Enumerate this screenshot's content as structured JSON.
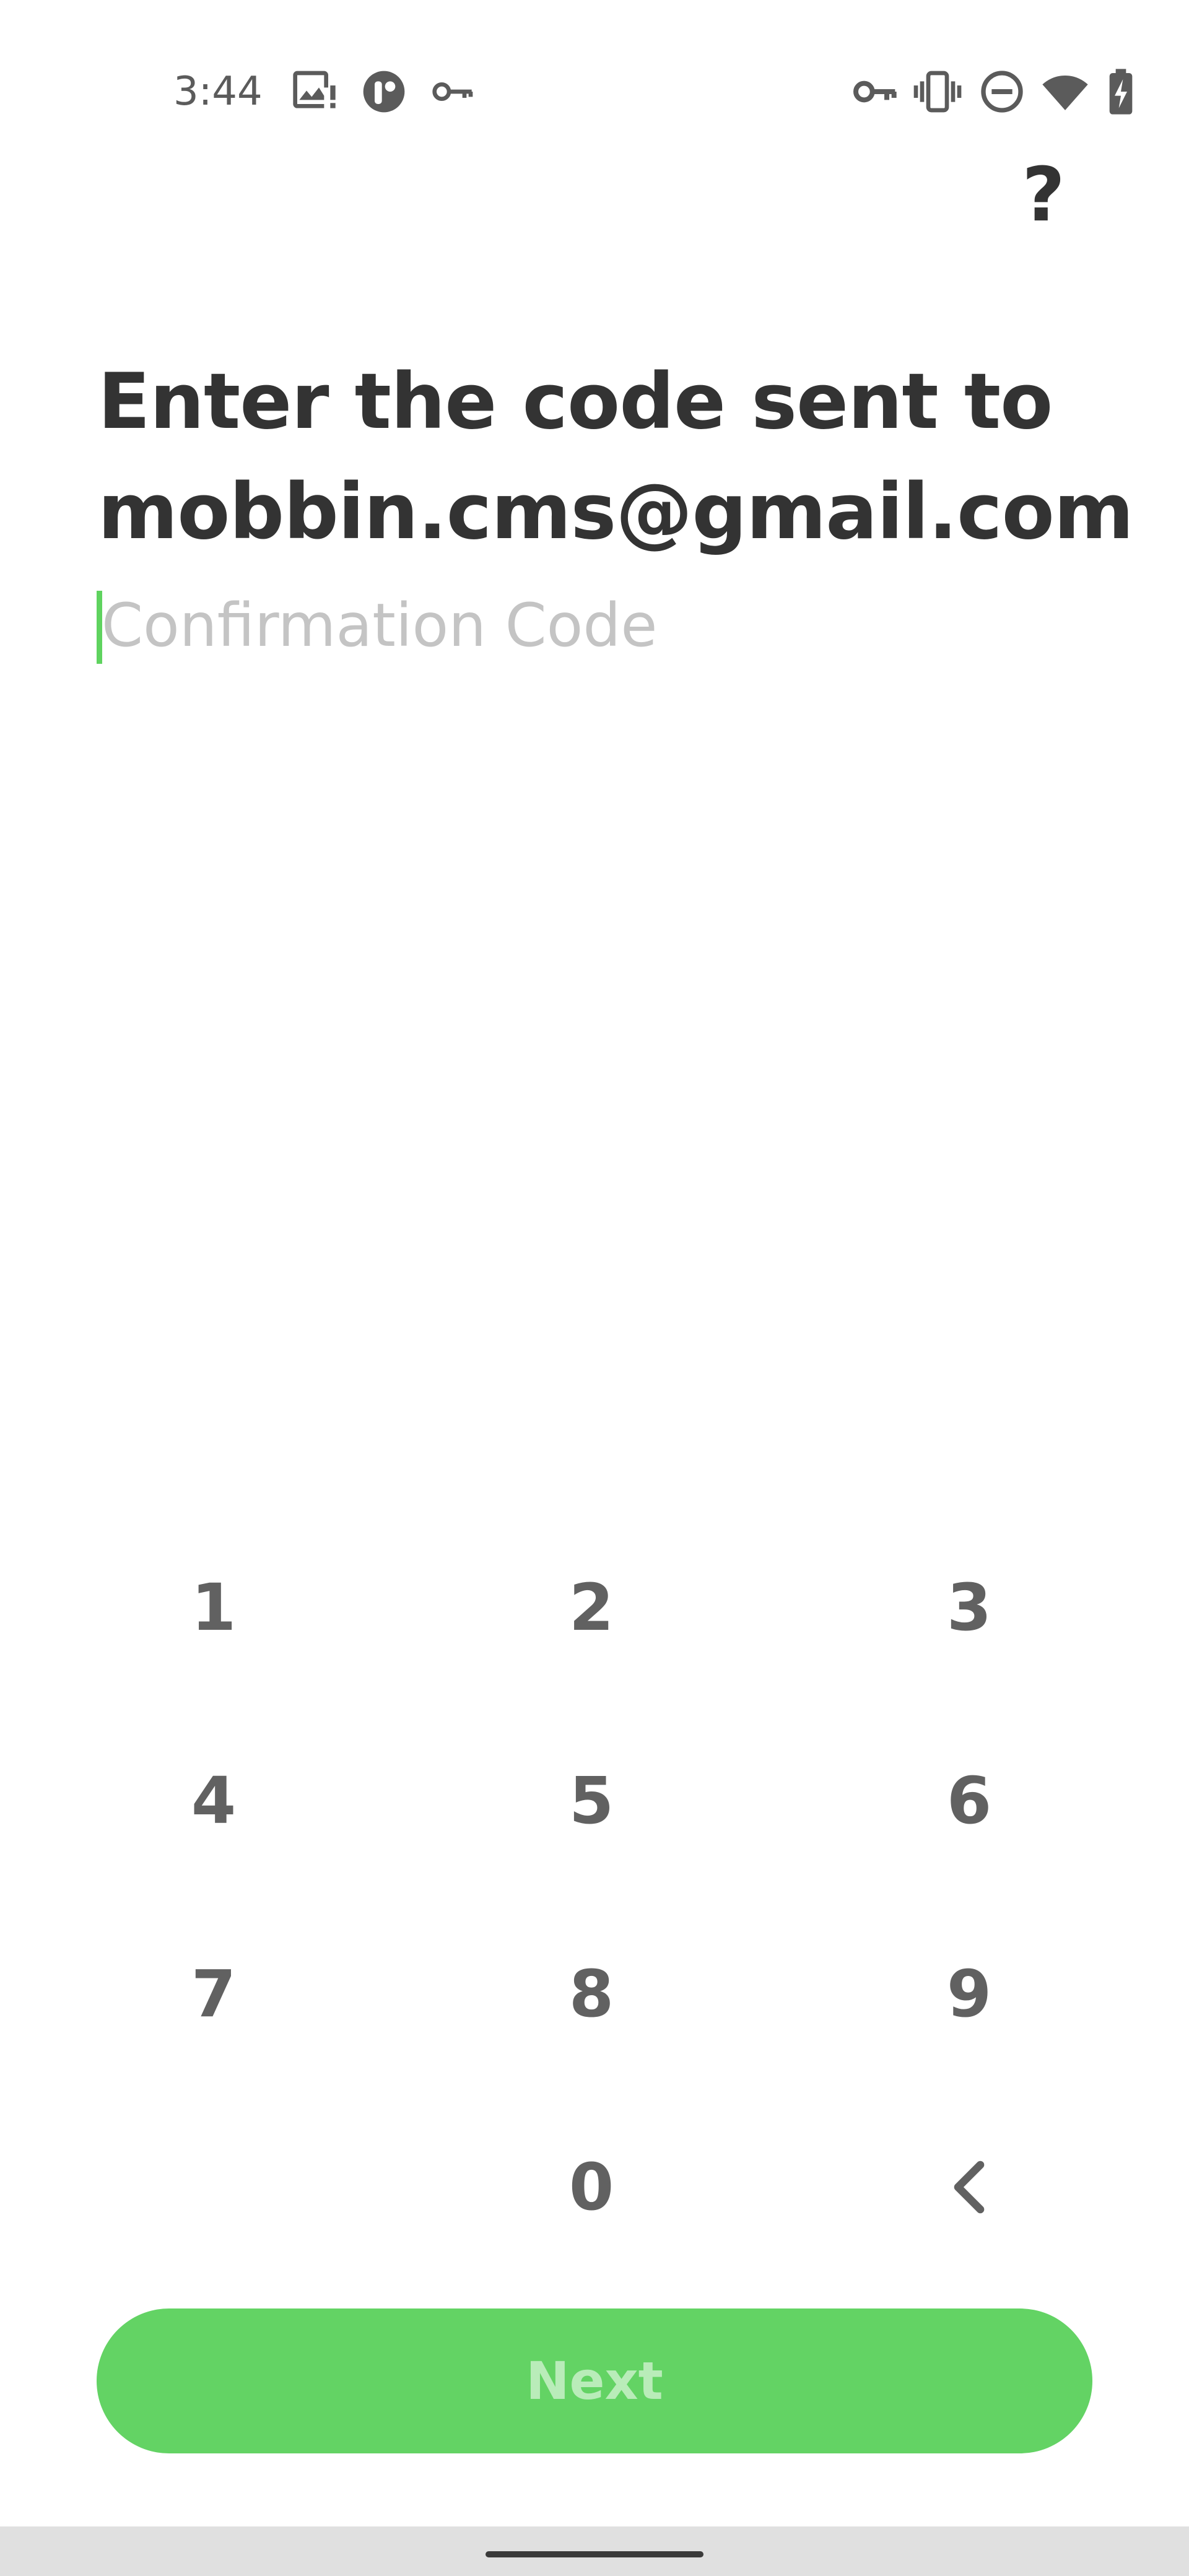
{
  "status_bar": {
    "time": "3:44",
    "left_icons": [
      "image-alert-icon",
      "app-badge-icon",
      "key-icon"
    ],
    "right_icons": [
      "vpn-key-icon",
      "vibrate-icon",
      "do-not-disturb-icon",
      "wifi-icon",
      "battery-charging-icon"
    ]
  },
  "header": {
    "help_label": "?"
  },
  "main": {
    "title_line1": "Enter the code sent to",
    "title_line2": "mobbin.cms@gmail.com",
    "code_input": {
      "placeholder": "Confirmation Code",
      "value": ""
    }
  },
  "keypad": {
    "keys": [
      "1",
      "2",
      "3",
      "4",
      "5",
      "6",
      "7",
      "8",
      "9",
      "",
      "0",
      "backspace-icon"
    ]
  },
  "footer": {
    "next_label": "Next"
  },
  "colors": {
    "accent": "#63d364",
    "accent_text_disabled": "#b9ecb9",
    "title_text": "#333333",
    "keypad_text": "#616161",
    "placeholder": "#c4c4c4"
  }
}
